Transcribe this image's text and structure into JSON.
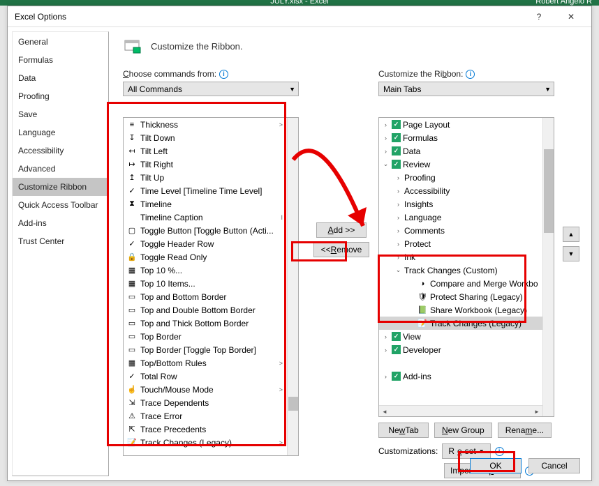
{
  "excel_titlebar": {
    "doc": "JULY.xlsx - Excel",
    "user": "Robert Angelo R"
  },
  "dialog": {
    "title": "Excel Options",
    "close": "✕",
    "help": "?"
  },
  "sidebar": {
    "items": [
      {
        "label": "General"
      },
      {
        "label": "Formulas"
      },
      {
        "label": "Data"
      },
      {
        "label": "Proofing"
      },
      {
        "label": "Save"
      },
      {
        "label": "Language"
      },
      {
        "label": "Accessibility"
      },
      {
        "label": "Advanced"
      },
      {
        "label": "Customize Ribbon",
        "selected": true
      },
      {
        "label": "Quick Access Toolbar"
      },
      {
        "label": "Add-ins"
      },
      {
        "label": "Trust Center"
      }
    ]
  },
  "heading": "Customize the Ribbon.",
  "left": {
    "label": "Choose commands from:",
    "dropdown": "All Commands",
    "items": [
      {
        "icon": "≡",
        "label": "Thickness",
        "sub": ">"
      },
      {
        "icon": "↧",
        "label": "Tilt Down"
      },
      {
        "icon": "↤",
        "label": "Tilt Left"
      },
      {
        "icon": "↦",
        "label": "Tilt Right"
      },
      {
        "icon": "↥",
        "label": "Tilt Up"
      },
      {
        "icon": "✓",
        "label": "Time Level [Timeline Time Level]"
      },
      {
        "icon": "⧗",
        "label": "Timeline"
      },
      {
        "icon": "",
        "label": "Timeline Caption",
        "sub": "I"
      },
      {
        "icon": "▢",
        "label": "Toggle Button [Toggle Button (Acti..."
      },
      {
        "icon": "✓",
        "label": "Toggle Header Row"
      },
      {
        "icon": "🔒",
        "label": "Toggle Read Only"
      },
      {
        "icon": "▦",
        "label": "Top 10 %..."
      },
      {
        "icon": "▦",
        "label": "Top 10 Items..."
      },
      {
        "icon": "▭",
        "label": "Top and Bottom Border"
      },
      {
        "icon": "▭",
        "label": "Top and Double Bottom Border"
      },
      {
        "icon": "▭",
        "label": "Top and Thick Bottom Border"
      },
      {
        "icon": "▭",
        "label": "Top Border"
      },
      {
        "icon": "▭",
        "label": "Top Border [Toggle Top Border]"
      },
      {
        "icon": "▦",
        "label": "Top/Bottom Rules",
        "sub": ">"
      },
      {
        "icon": "✓",
        "label": "Total Row"
      },
      {
        "icon": "☝",
        "label": "Touch/Mouse Mode",
        "sub": ">"
      },
      {
        "icon": "⇲",
        "label": "Trace Dependents"
      },
      {
        "icon": "⚠",
        "label": "Trace Error"
      },
      {
        "icon": "⇱",
        "label": "Trace Precedents"
      },
      {
        "icon": "📝",
        "label": "Track Changes (Legacy)",
        "sub": ">"
      }
    ]
  },
  "mid": {
    "add": "Add >>",
    "remove": "<< Remove"
  },
  "right": {
    "label": "Customize the Ribbon:",
    "dropdown": "Main Tabs",
    "tree": [
      {
        "exp": ">",
        "chk": true,
        "ind": 0,
        "label": "Page Layout"
      },
      {
        "exp": ">",
        "chk": true,
        "ind": 0,
        "label": "Formulas"
      },
      {
        "exp": ">",
        "chk": true,
        "ind": 0,
        "label": "Data"
      },
      {
        "exp": "v",
        "chk": true,
        "ind": 0,
        "label": "Review"
      },
      {
        "exp": ">",
        "chk": false,
        "ind": 1,
        "label": "Proofing"
      },
      {
        "exp": ">",
        "chk": false,
        "ind": 1,
        "label": "Accessibility"
      },
      {
        "exp": ">",
        "chk": false,
        "ind": 1,
        "label": "Insights"
      },
      {
        "exp": ">",
        "chk": false,
        "ind": 1,
        "label": "Language"
      },
      {
        "exp": ">",
        "chk": false,
        "ind": 1,
        "label": "Comments"
      },
      {
        "exp": ">",
        "chk": false,
        "ind": 1,
        "label": "Protect"
      },
      {
        "exp": ">",
        "chk": false,
        "ind": 1,
        "label": "Ink"
      },
      {
        "exp": "v",
        "chk": false,
        "ind": 1,
        "label": "Track Changes (Custom)"
      },
      {
        "exp": "",
        "chk": false,
        "ind": 2,
        "icon": "◑",
        "label": "Compare and Merge Workbo"
      },
      {
        "exp": "",
        "chk": false,
        "ind": 2,
        "icon": "🛡",
        "label": "Protect Sharing (Legacy)"
      },
      {
        "exp": "",
        "chk": false,
        "ind": 2,
        "icon": "📗",
        "label": "Share Workbook (Legacy)"
      },
      {
        "exp": "",
        "chk": false,
        "ind": 2,
        "icon": "📝",
        "label": "Track Changes (Legacy)",
        "selected": true
      },
      {
        "exp": ">",
        "chk": true,
        "ind": 0,
        "label": "View"
      },
      {
        "exp": ">",
        "chk": true,
        "ind": 0,
        "label": "Developer"
      },
      {
        "exp": "",
        "chk": false,
        "ind": 0,
        "label": ""
      },
      {
        "exp": ">",
        "chk": true,
        "ind": 0,
        "label": "Add-ins"
      }
    ],
    "newtab": "New Tab",
    "newgroup": "New Group",
    "rename": "Rename...",
    "cust_label": "Customizations:",
    "reset": "Reset",
    "importexport": "Import/Export",
    "up": "▲",
    "down": "▼"
  },
  "footer": {
    "ok": "OK",
    "cancel": "Cancel"
  }
}
